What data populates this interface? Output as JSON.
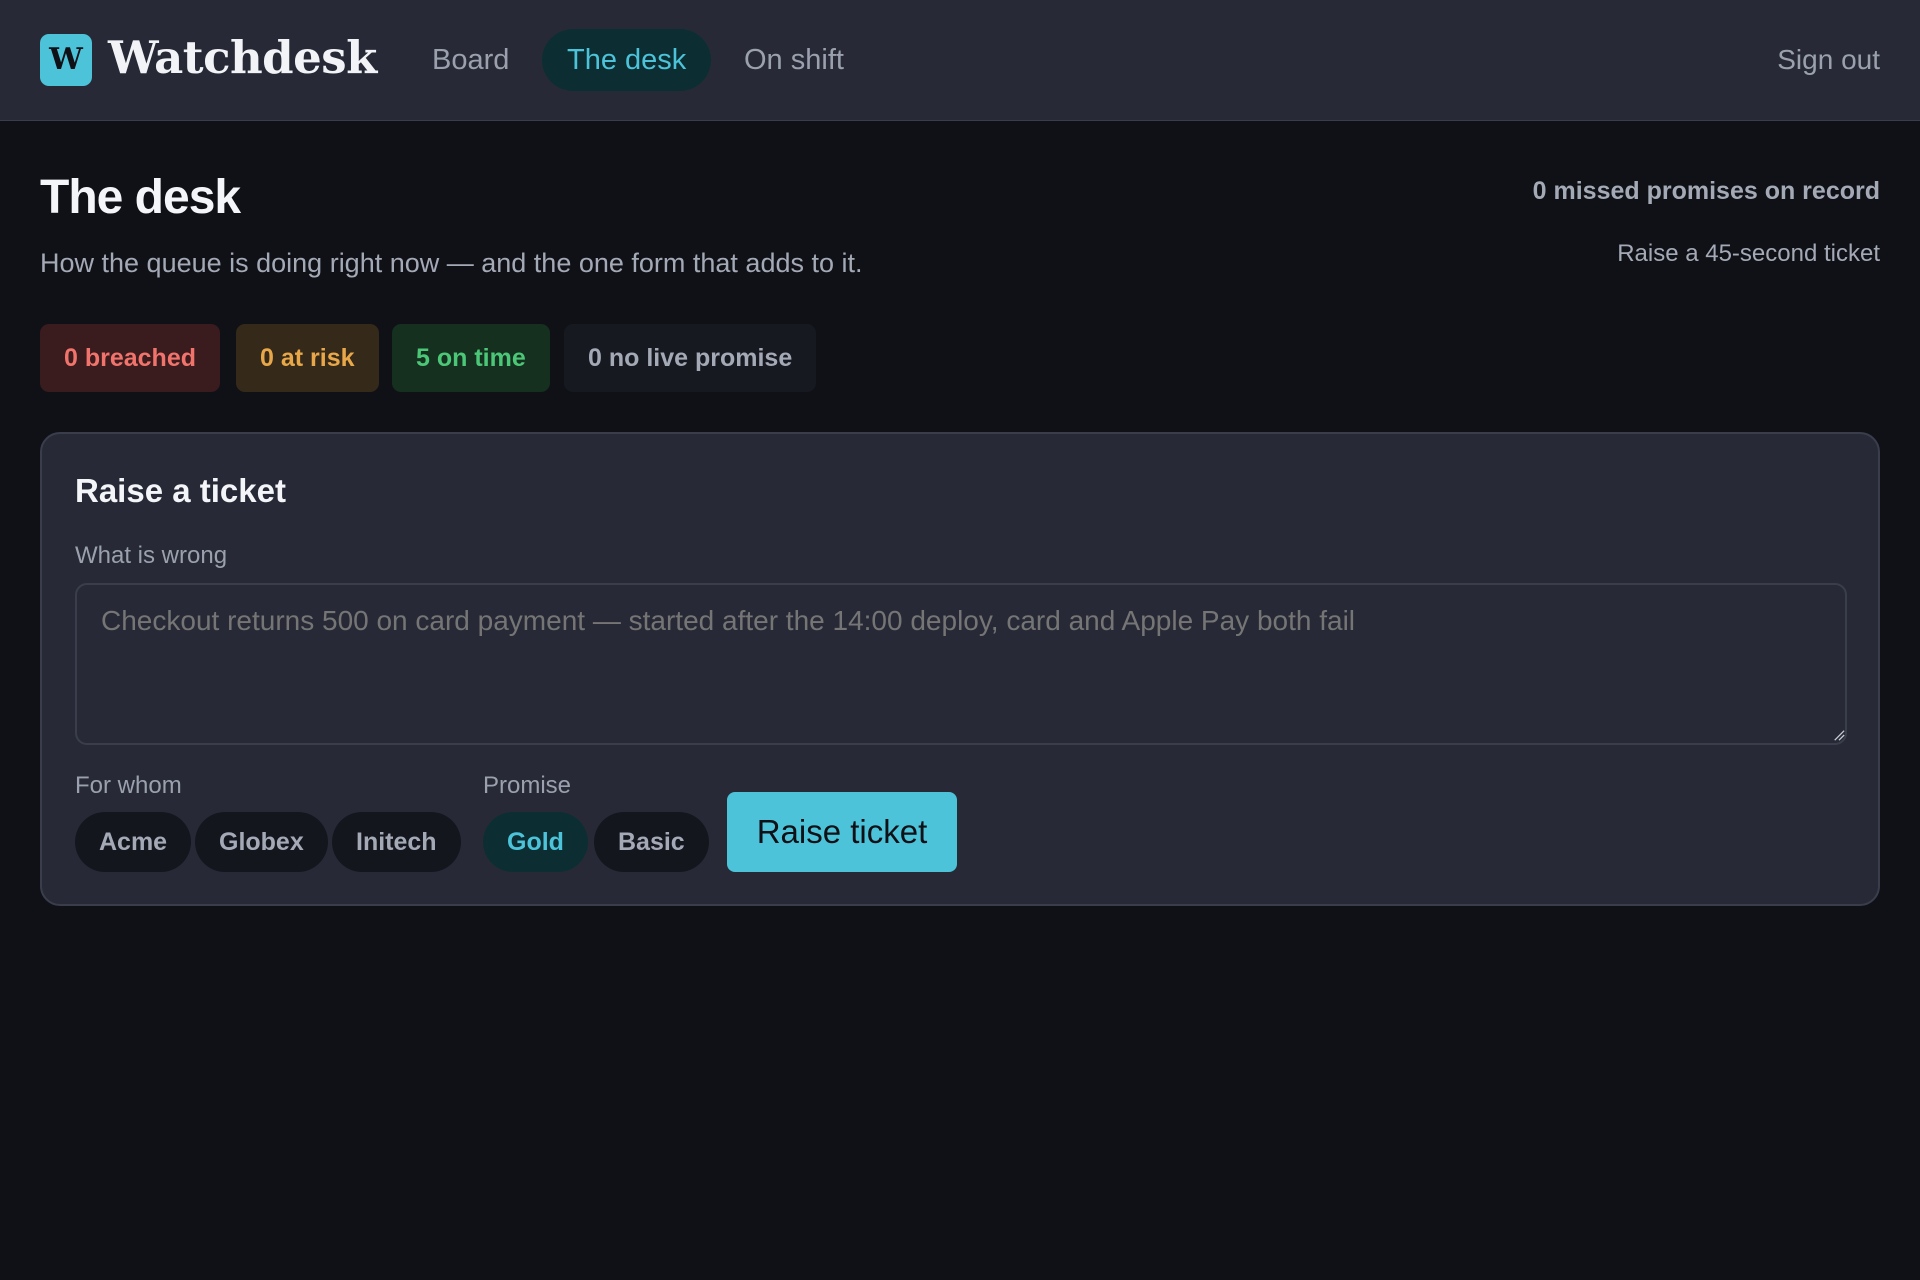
{
  "header": {
    "logo_letter": "W",
    "brand": "Watchdesk",
    "nav": [
      {
        "label": "Board"
      },
      {
        "label": "The desk",
        "active": true
      },
      {
        "label": "On shift"
      }
    ],
    "signout_label": "Sign out"
  },
  "page": {
    "title": "The desk",
    "subtitle": "How the queue is doing right now — and the one form that adds to it.",
    "missed_promises": "0 missed promises on record",
    "quick_link": "Raise a 45-second ticket"
  },
  "stats": {
    "breached": "0 breached",
    "at_risk": "0 at risk",
    "on_time": "5 on time",
    "no_live_promise": "0 no live promise"
  },
  "ticket_form": {
    "title": "Raise a ticket",
    "what_label": "What is wrong",
    "what_placeholder": "Checkout returns 500 on card payment — started after the 14:00 deploy, card and Apple Pay both fail",
    "whom_label": "For whom",
    "customers": [
      "Acme",
      "Globex",
      "Initech"
    ],
    "promise_label": "Promise",
    "promises": [
      {
        "label": "Gold",
        "selected": true
      },
      {
        "label": "Basic",
        "selected": false
      }
    ],
    "submit_label": "Raise ticket"
  },
  "colors": {
    "accent": "#4cc3d9",
    "breached": "#f0746c",
    "at_risk": "#e8a84a",
    "on_time": "#4bc777"
  }
}
